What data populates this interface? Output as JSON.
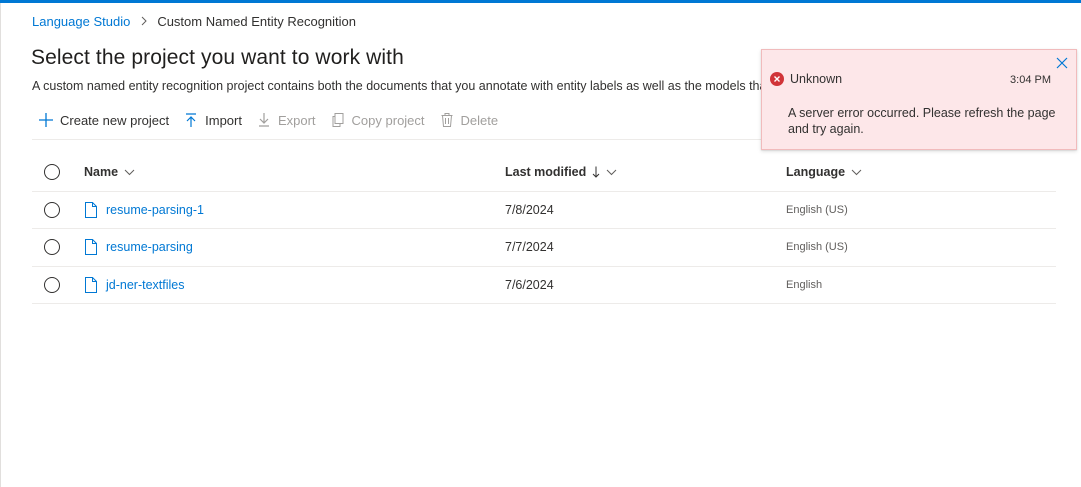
{
  "breadcrumb": {
    "root": "Language Studio",
    "current": "Custom Named Entity Recognition"
  },
  "page": {
    "title": "Select the project you want to work with",
    "description": "A custom named entity recognition project contains both the documents that you annotate with entity labels as well as the models that"
  },
  "toolbar": {
    "create_label": "Create new project",
    "import_label": "Import",
    "export_label": "Export",
    "copy_label": "Copy project",
    "delete_label": "Delete"
  },
  "table": {
    "headers": {
      "name": "Name",
      "last_modified": "Last modified",
      "language": "Language"
    },
    "rows": [
      {
        "name": "resume-parsing-1",
        "last_modified": "7/8/2024",
        "language": "English (US)"
      },
      {
        "name": "resume-parsing",
        "last_modified": "7/7/2024",
        "language": "English (US)"
      },
      {
        "name": "jd-ner-textfiles",
        "last_modified": "7/6/2024",
        "language": "English"
      }
    ]
  },
  "toast": {
    "title": "Unknown",
    "time": "3:04 PM",
    "message": "A server error occurred. Please refresh the page and try again."
  },
  "colors": {
    "accent": "#0078d4",
    "error": "#d13438",
    "error_bg": "#fde7e9",
    "disabled": "#a19f9d"
  },
  "icons": {
    "breadcrumb_separator": "chevron-right-icon",
    "create": "plus-icon",
    "import": "upload-icon",
    "export": "download-icon",
    "copy": "copy-icon",
    "delete": "trash-icon",
    "file": "file-icon",
    "sort": "arrow-down-icon",
    "header_menu": "chevron-down-icon",
    "error": "error-circle-icon",
    "close": "close-icon"
  }
}
